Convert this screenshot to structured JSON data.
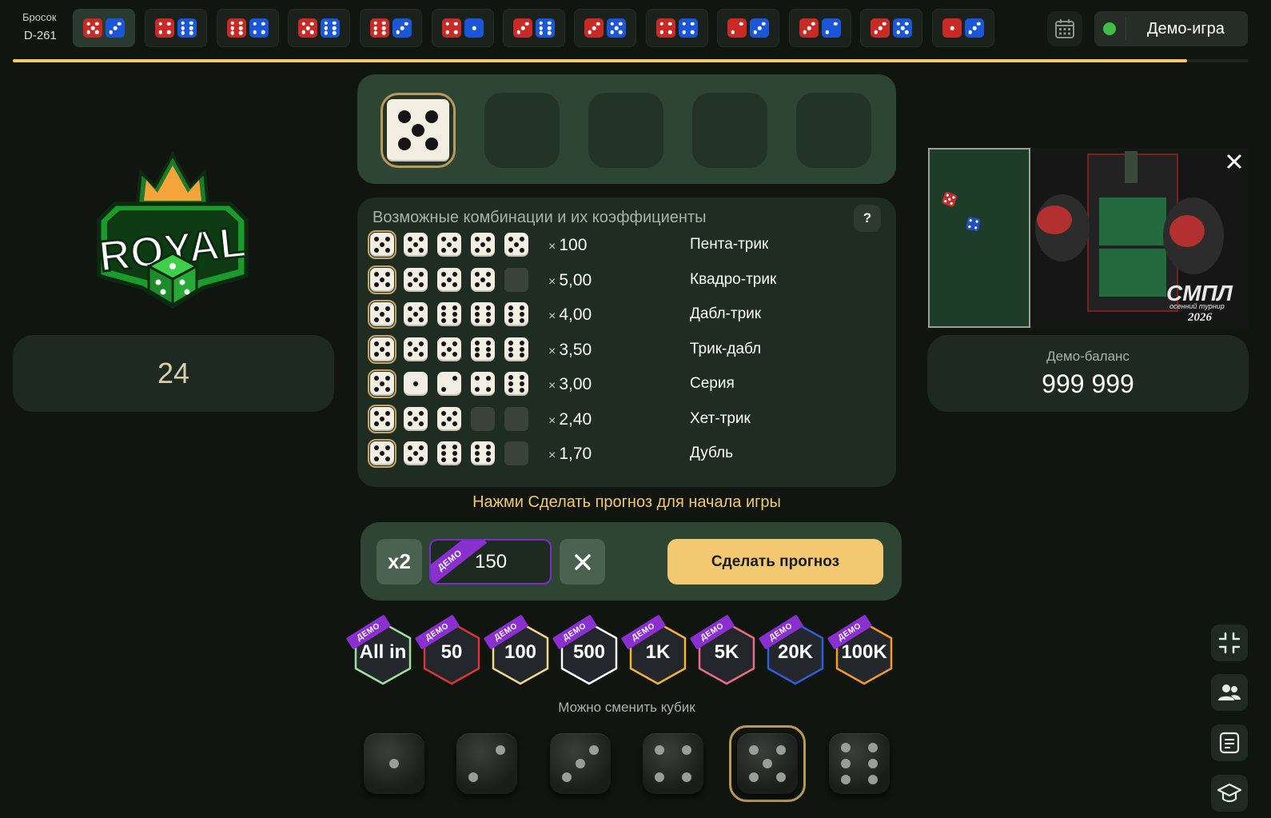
{
  "top": {
    "roll_label": "Бросок",
    "roll_id": "D-261",
    "demo_button": "Демо-игра",
    "progress": 0.95,
    "history": [
      {
        "red": 5,
        "blue": 3,
        "active": true
      },
      {
        "red": 4,
        "blue": 6
      },
      {
        "red": 6,
        "blue": 4
      },
      {
        "red": 5,
        "blue": 6
      },
      {
        "red": 6,
        "blue": 3
      },
      {
        "red": 4,
        "blue": 1
      },
      {
        "red": 3,
        "blue": 6
      },
      {
        "red": 3,
        "blue": 5
      },
      {
        "red": 4,
        "blue": 4
      },
      {
        "red": 2,
        "blue": 3
      },
      {
        "red": 3,
        "blue": 2
      },
      {
        "red": 3,
        "blue": 5
      },
      {
        "red": 1,
        "blue": 3
      }
    ]
  },
  "logo_text": "ROYAL",
  "counter": "24",
  "slots": [
    5,
    null,
    null,
    null,
    null
  ],
  "combos": {
    "title": "Возможные комбинации и их коэффициенты",
    "help": "?",
    "rows": [
      {
        "dice": [
          5,
          5,
          5,
          5,
          5
        ],
        "mult": "100",
        "name": "Пента-трик"
      },
      {
        "dice": [
          5,
          5,
          5,
          5,
          0
        ],
        "mult": "5,00",
        "name": "Квадро-трик"
      },
      {
        "dice": [
          5,
          5,
          6,
          6,
          6
        ],
        "mult": "4,00",
        "name": "Дабл-трик"
      },
      {
        "dice": [
          5,
          5,
          5,
          6,
          6
        ],
        "mult": "3,50",
        "name": "Трик-дабл"
      },
      {
        "dice": [
          5,
          1,
          2,
          4,
          6
        ],
        "mult": "3,00",
        "name": "Серия"
      },
      {
        "dice": [
          5,
          5,
          5,
          0,
          0
        ],
        "mult": "2,40",
        "name": "Хет-трик"
      },
      {
        "dice": [
          5,
          5,
          6,
          6,
          0
        ],
        "mult": "1,70",
        "name": "Дубль"
      }
    ]
  },
  "hint": "Нажми Сделать прогноз для начала игры",
  "bet": {
    "x2": "x2",
    "value": "150",
    "ribbon": "ДЕМО",
    "predict": "Сделать прогноз"
  },
  "chips": [
    {
      "label": "All in",
      "color": "#9fe0a0"
    },
    {
      "label": "50",
      "color": "#d8343a"
    },
    {
      "label": "100",
      "color": "#efd78a"
    },
    {
      "label": "500",
      "color": "#ffffff"
    },
    {
      "label": "1K",
      "color": "#f2b23c"
    },
    {
      "label": "5K",
      "color": "#e86a8c"
    },
    {
      "label": "20K",
      "color": "#2c5fd8"
    },
    {
      "label": "100K",
      "color": "#f29a2c"
    }
  ],
  "change_label": "Можно сменить кубик",
  "picker": [
    1,
    2,
    3,
    4,
    5,
    6
  ],
  "picker_selected": 5,
  "video": {
    "brand": "СМПЛ",
    "sub": "осенний турнир",
    "year": "2026"
  },
  "balance": {
    "label": "Демо-баланс",
    "value": "999 999"
  },
  "colors": {
    "accent": "#f2c870",
    "panel": "#2e4533",
    "demo_purple": "#8a2fd0",
    "red_die": "#c92a26",
    "blue_die": "#1a56d8"
  }
}
